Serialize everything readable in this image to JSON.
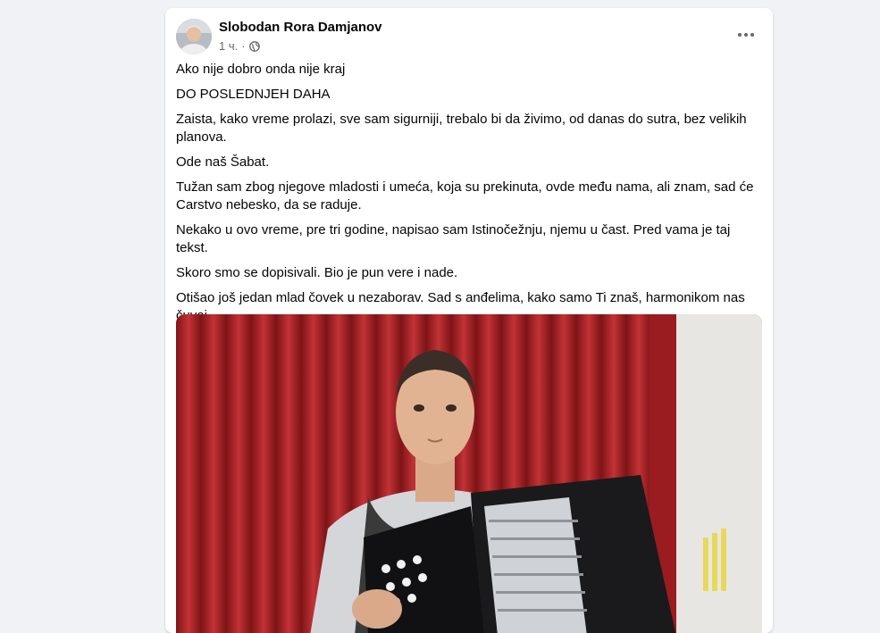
{
  "post": {
    "author": "Slobodan Rora Damjanov",
    "time": "1 ч.",
    "separator": "·",
    "privacy_icon": "globe-icon",
    "more_icon": "more-options-icon",
    "paragraphs": [
      "Ako nije dobro onda nije kraj",
      "DO POSLEDNJEH DAHA",
      "Zaista, kako vreme prolazi, sve sam sigurniji, trebalo bi da živimo, od danas do sutra, bez velikih planova.",
      "Ode naš Šabat.",
      "Tužan sam zbog njegove mladosti i umeća, koja su prekinuta, ovde među nama, ali znam, sad će Carstvo nebesko, da se raduje.",
      "Nekako u ovo vreme, pre tri godine, napisao sam Istinočežnju, njemu u čast. Pred vama je taj tekst.",
      "Skoro smo se dopisivali. Bio je pun vere i nade.",
      "Otišao još jedan mlad čovek u nezaborav. Sad s anđelima, kako samo Ti znaš, harmonikom nas čuvaj."
    ]
  },
  "colors": {
    "curtain": "#a8252a",
    "wall": "#e8e6e3",
    "secondary_text": "#65676b"
  }
}
